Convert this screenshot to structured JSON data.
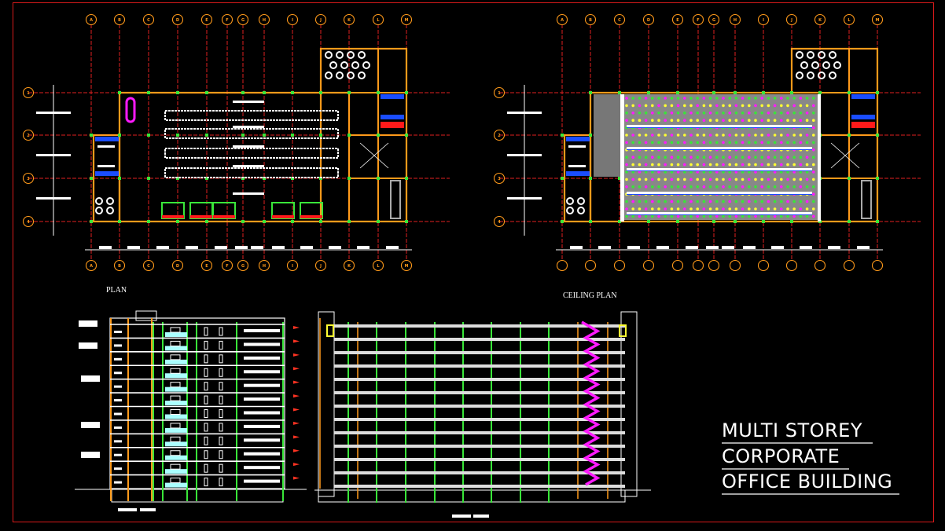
{
  "drawing": {
    "title_lines": [
      "MULTI STOREY",
      "CORPORATE",
      "OFFICE BUILDING"
    ],
    "views": {
      "plan": {
        "label": "PLAN"
      },
      "ceiling_plan": {
        "label": "CEILING PLAN"
      }
    },
    "grid": {
      "columns": [
        "A",
        "B",
        "C",
        "D",
        "E",
        "F",
        "G",
        "H",
        "I",
        "J",
        "K",
        "L",
        "M"
      ],
      "rows": [
        "1",
        "2",
        "3",
        "4"
      ]
    },
    "elevation": {
      "floors": 12
    },
    "section": {
      "floors": 12
    },
    "colors": {
      "background": "#000000",
      "frame": "#d81a1a",
      "grid_line": "#e02020",
      "grid_bubble": "#ff9a1a",
      "wall": "#ff9a1a",
      "column": "#39e639",
      "furniture": "#ffffff",
      "stair": "#ff1aff",
      "toilet_blue": "#1a4dff",
      "ceiling_yellow": "#ffff33",
      "glass": "#aaffff"
    }
  }
}
